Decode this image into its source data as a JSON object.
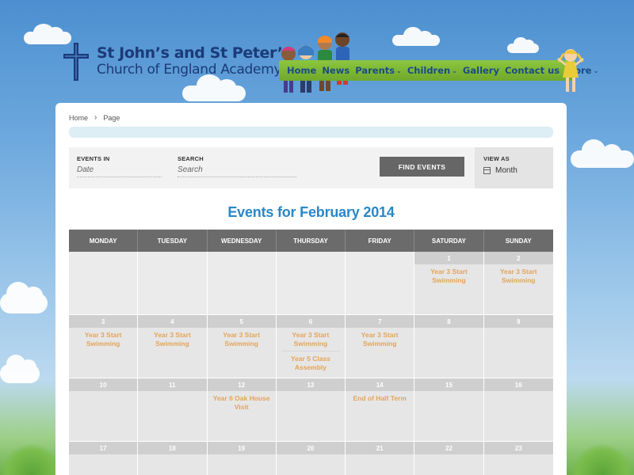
{
  "header": {
    "logo_line1": "St John’s and St Peter’s",
    "logo_line2": "Church of England Academy"
  },
  "nav": {
    "items": [
      {
        "label": "Home"
      },
      {
        "label": "News"
      },
      {
        "label": "Parents",
        "caret": "⌄"
      },
      {
        "label": "Children",
        "caret": "⌄"
      },
      {
        "label": "Gallery"
      },
      {
        "label": "Contact us"
      },
      {
        "label": "more",
        "caret": "⌄"
      }
    ]
  },
  "breadcrumb": {
    "home": "Home",
    "separator": "›",
    "current": "Page"
  },
  "filters": {
    "events_in_label": "EVENTS IN",
    "events_in_placeholder": "Date",
    "search_label": "SEARCH",
    "search_placeholder": "Search",
    "find_button": "FIND EVENTS",
    "view_as_label": "VIEW AS",
    "view_as_value": "Month"
  },
  "calendar": {
    "title": "Events for February 2014",
    "weekdays": [
      "MONDAY",
      "TUESDAY",
      "WEDNESDAY",
      "THURSDAY",
      "FRIDAY",
      "SATURDAY",
      "SUNDAY"
    ],
    "weeks": [
      [
        {
          "day": "",
          "events": []
        },
        {
          "day": "",
          "events": []
        },
        {
          "day": "",
          "events": []
        },
        {
          "day": "",
          "events": []
        },
        {
          "day": "",
          "events": []
        },
        {
          "day": "1",
          "events": [
            "Year 3 Start Swimming"
          ]
        },
        {
          "day": "2",
          "events": [
            "Year 3 Start Swimming"
          ]
        }
      ],
      [
        {
          "day": "3",
          "events": [
            "Year 3 Start Swimming"
          ]
        },
        {
          "day": "4",
          "events": [
            "Year 3 Start Swimming"
          ]
        },
        {
          "day": "5",
          "events": [
            "Year 3 Start Swimming"
          ]
        },
        {
          "day": "6",
          "events": [
            "Year 3 Start Swimming",
            "Year 5 Class Assembly"
          ]
        },
        {
          "day": "7",
          "events": [
            "Year 3 Start Swimming"
          ]
        },
        {
          "day": "8",
          "events": []
        },
        {
          "day": "9",
          "events": []
        }
      ],
      [
        {
          "day": "10",
          "events": []
        },
        {
          "day": "11",
          "events": []
        },
        {
          "day": "12",
          "events": [
            "Year 6 Oak House Visit"
          ]
        },
        {
          "day": "13",
          "events": []
        },
        {
          "day": "14",
          "events": [
            "End of Half Term"
          ]
        },
        {
          "day": "15",
          "events": []
        },
        {
          "day": "16",
          "events": []
        }
      ],
      [
        {
          "day": "17",
          "events": []
        },
        {
          "day": "18",
          "events": []
        },
        {
          "day": "19",
          "events": []
        },
        {
          "day": "20",
          "events": []
        },
        {
          "day": "21",
          "events": []
        },
        {
          "day": "22",
          "events": []
        },
        {
          "day": "23",
          "events": []
        }
      ]
    ]
  },
  "colors": {
    "nav_bg": "#7bb534",
    "nav_text": "#1a4b86",
    "title_blue": "#2a87c7",
    "event_orange": "#e4a45a",
    "header_gray": "#6b6b6b"
  }
}
